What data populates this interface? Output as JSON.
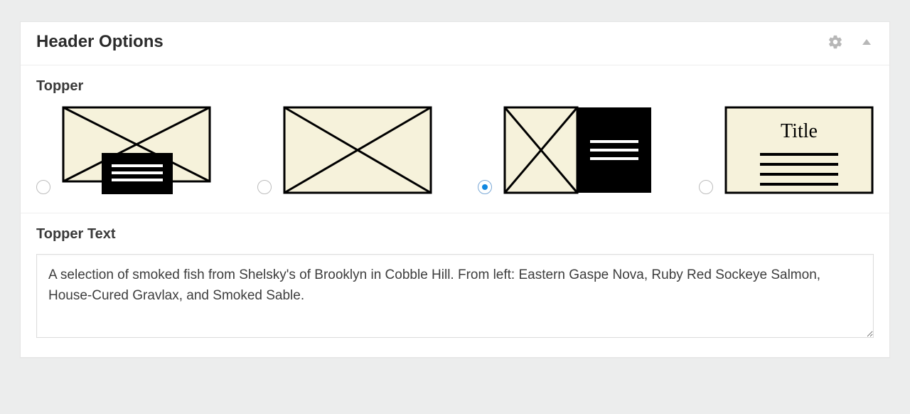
{
  "panel": {
    "title": "Header Options"
  },
  "topper": {
    "label": "Topper",
    "selected_index": 2,
    "options": [
      {
        "id": "overlay-caption"
      },
      {
        "id": "image-only"
      },
      {
        "id": "split-dark"
      },
      {
        "id": "title-text"
      }
    ],
    "option4_title": "Title"
  },
  "topper_text": {
    "label": "Topper Text",
    "value": "A selection of smoked fish from Shelsky's of Brooklyn in Cobble Hill. From left: Eastern Gaspe Nova, Ruby Red Sockeye Salmon, House-Cured Gravlax, and Smoked Sable."
  }
}
